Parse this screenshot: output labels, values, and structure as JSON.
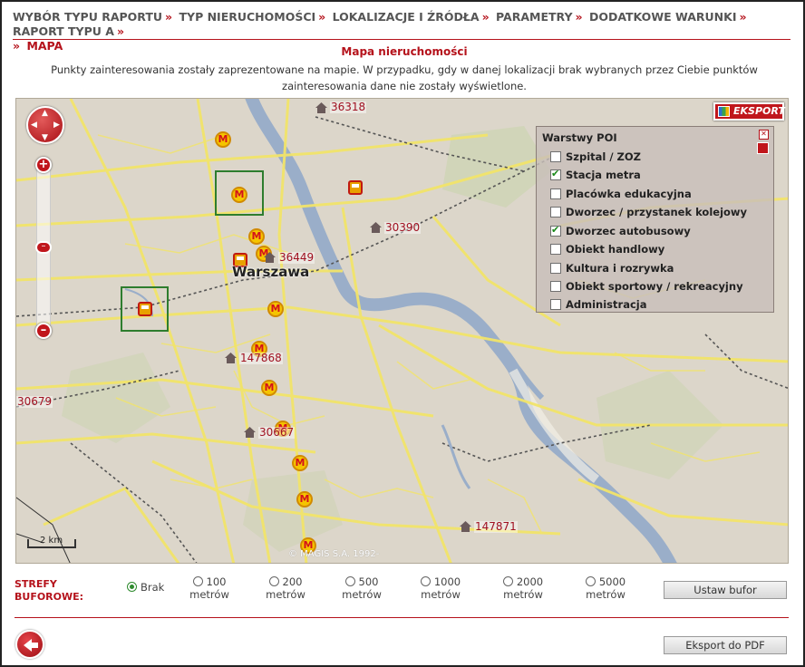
{
  "breadcrumb": {
    "items": [
      "WYBÓR TYPU RAPORTU",
      "TYP NIERUCHOMOŚCI",
      "LOKALIZACJE I ŹRÓDŁA",
      "PARAMETRY",
      "DODATKOWE WARUNKI",
      "RAPORT TYPU A"
    ],
    "separator": "»",
    "current": "MAPA"
  },
  "page_title": "Mapa nieruchomości",
  "description": "Punkty zainteresowania zostały zaprezentowane na mapie. W przypadku, gdy w danej lokalizacji brak wybranych przez Ciebie punktów zainteresowania dane nie zostały wyświetlone.",
  "map": {
    "city": "Warszawa",
    "properties": [
      "36318",
      "30390",
      "36449",
      "147868",
      "30667",
      "147871",
      "30679"
    ],
    "scale_label": "2 km",
    "copyright": "© MAGIS S.A. 1992-",
    "export_label": "EKSPORT",
    "colors": {
      "land": "#dcd6ca",
      "water": "#9aaec9",
      "road": "#f2e46a",
      "park": "#c4cfa7",
      "accent": "#b5121b"
    }
  },
  "layers": {
    "title": "Warstwy POI",
    "items": [
      {
        "label": "Szpital / ZOZ",
        "checked": false
      },
      {
        "label": "Stacja metra",
        "checked": true
      },
      {
        "label": "Placówka edukacyjna",
        "checked": false
      },
      {
        "label": "Dworzec / przystanek kolejowy",
        "checked": false
      },
      {
        "label": "Dworzec autobusowy",
        "checked": true
      },
      {
        "label": "Obiekt handlowy",
        "checked": false
      },
      {
        "label": "Kultura i rozrywka",
        "checked": false
      },
      {
        "label": "Obiekt sportowy / rekreacyjny",
        "checked": false
      },
      {
        "label": "Administracja",
        "checked": false
      }
    ]
  },
  "buffer": {
    "label": "STREFY BUFOROWE:",
    "options": [
      {
        "value": "Brak",
        "unit": "",
        "selected": true
      },
      {
        "value": "100",
        "unit": "metrów",
        "selected": false
      },
      {
        "value": "200",
        "unit": "metrów",
        "selected": false
      },
      {
        "value": "500",
        "unit": "metrów",
        "selected": false
      },
      {
        "value": "1000",
        "unit": "metrów",
        "selected": false
      },
      {
        "value": "2000",
        "unit": "metrów",
        "selected": false
      },
      {
        "value": "5000",
        "unit": "metrów",
        "selected": false
      }
    ],
    "set_button": "Ustaw bufor"
  },
  "footer": {
    "pdf_button": "Eksport do PDF"
  }
}
